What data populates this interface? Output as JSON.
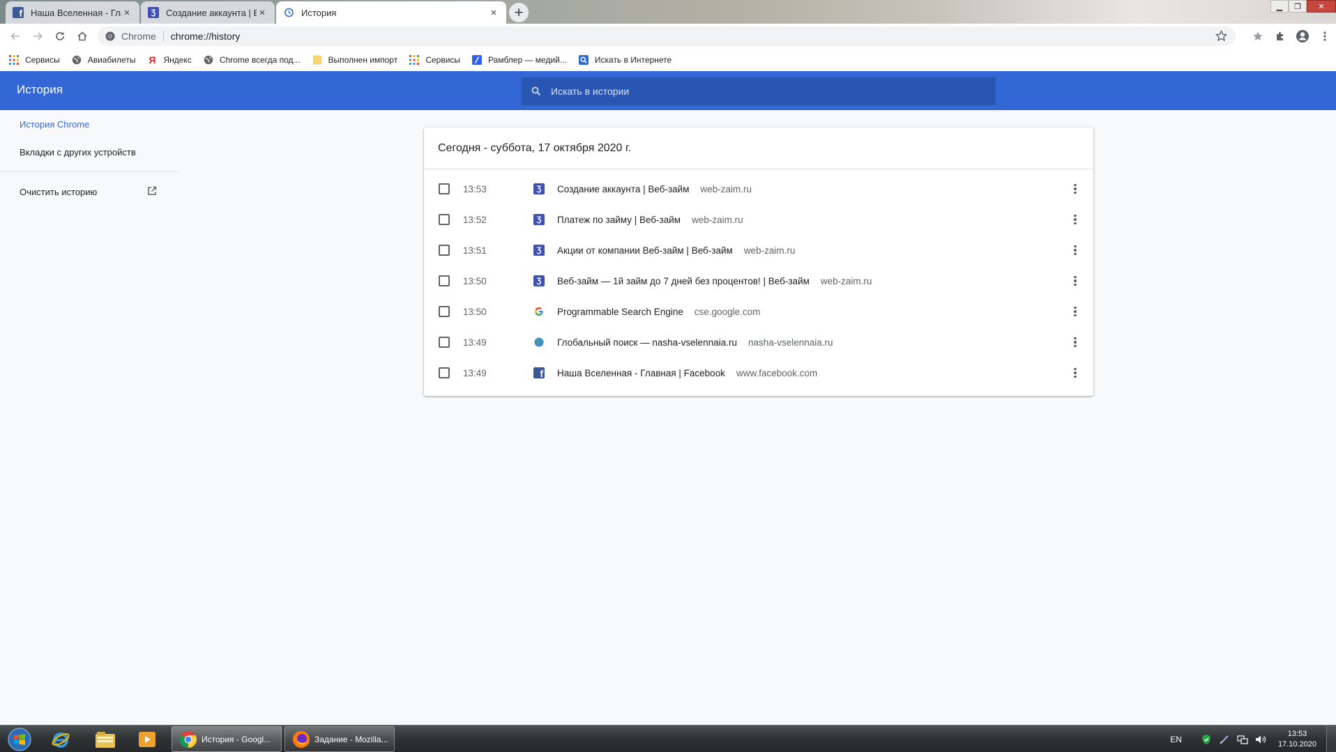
{
  "tabs": [
    {
      "title": "Наша Вселенная - Главная | Facebook",
      "favicon": "facebook-icon",
      "active": false
    },
    {
      "title": "Создание аккаунта | Веб-займ",
      "favicon": "webzaim-icon",
      "active": false
    },
    {
      "title": "История",
      "favicon": "history-icon",
      "active": true
    }
  ],
  "tab_close_glyph": "×",
  "new_tab_glyph": "+",
  "window_controls": {
    "minimize": "▁",
    "restore": "❐",
    "close": "✕"
  },
  "omnibox": {
    "scheme_label": "Chrome",
    "url": "chrome://history"
  },
  "bookmarks": [
    {
      "label": "Сервисы",
      "icon": "apps-grid-icon"
    },
    {
      "label": "Авиабилеты",
      "icon": "globe-icon"
    },
    {
      "label": "Яндекс",
      "icon": "yandex-icon"
    },
    {
      "label": "Chrome всегда под...",
      "icon": "globe-icon"
    },
    {
      "label": "Выполнен импорт",
      "icon": "folder-icon"
    },
    {
      "label": "Сервисы",
      "icon": "apps-grid-icon"
    },
    {
      "label": "Рамблер — медий...",
      "icon": "rambler-icon"
    },
    {
      "label": "Искать в Интернете",
      "icon": "search-icon"
    }
  ],
  "header": {
    "title": "История",
    "search_placeholder": "Искать в истории"
  },
  "sidebar": {
    "items": [
      {
        "label": "История Chrome",
        "selected": true
      },
      {
        "label": "Вкладки с других устройств",
        "selected": false
      }
    ],
    "clear_label": "Очистить историю"
  },
  "history": {
    "date_heading": "Сегодня - суббота, 17 октября 2020 г.",
    "entries": [
      {
        "time": "13:53",
        "title": "Создание аккаунта | Веб-займ",
        "domain": "web-zaim.ru",
        "favicon": "webzaim-icon"
      },
      {
        "time": "13:52",
        "title": "Платеж по займу | Веб-займ",
        "domain": "web-zaim.ru",
        "favicon": "webzaim-icon"
      },
      {
        "time": "13:51",
        "title": "Акции от компании Веб-займ | Веб-займ",
        "domain": "web-zaim.ru",
        "favicon": "webzaim-icon"
      },
      {
        "time": "13:50",
        "title": "Веб-займ — 1й займ до 7 дней без процентов! | Веб-займ",
        "domain": "web-zaim.ru",
        "favicon": "webzaim-icon"
      },
      {
        "time": "13:50",
        "title": "Programmable Search Engine",
        "domain": "cse.google.com",
        "favicon": "google-icon"
      },
      {
        "time": "13:49",
        "title": "Глобальный поиск — nasha-vselennaia.ru",
        "domain": "nasha-vselennaia.ru",
        "favicon": "earth-icon"
      },
      {
        "time": "13:49",
        "title": "Наша Вселенная - Главная | Facebook",
        "domain": "www.facebook.com",
        "favicon": "facebook-icon"
      }
    ]
  },
  "taskbar": {
    "tasks": [
      {
        "label": "История - Googl...",
        "icon": "chrome-icon"
      },
      {
        "label": "Задание - Mozilla...",
        "icon": "firefox-icon"
      }
    ],
    "lang": "EN",
    "clock_time": "13:53",
    "clock_date": "17.10.2020"
  },
  "colors": {
    "accent": "#3367d6",
    "header_search": "#2a56b3",
    "webzaim": "#3f51b5",
    "facebook": "#3b5998"
  }
}
